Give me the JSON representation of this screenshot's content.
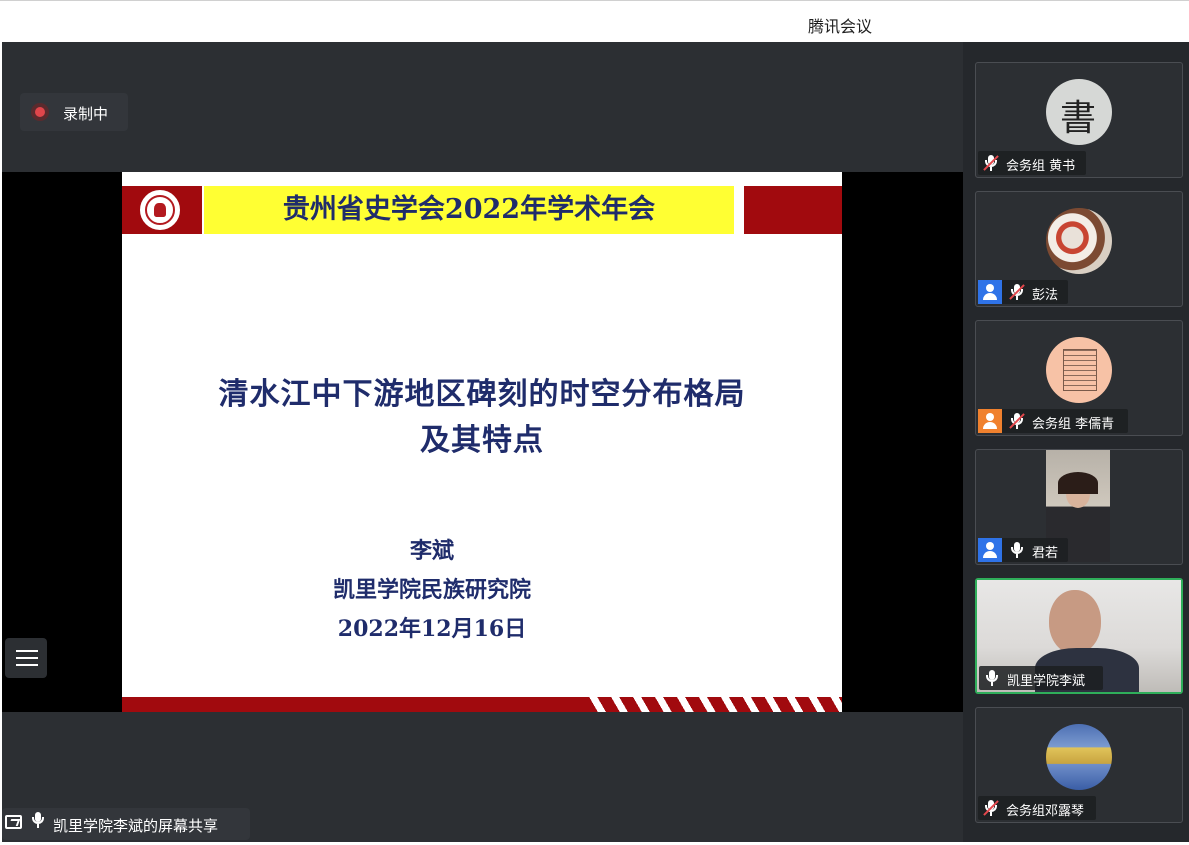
{
  "app": {
    "title": "腾讯会议"
  },
  "recording": {
    "label": "录制中"
  },
  "slide": {
    "conference_title": "贵州省史学会2022年学术年会",
    "paper_title_line1": "清水江中下游地区碑刻的时空分布格局",
    "paper_title_line2": "及其特点",
    "author": "李斌",
    "institution": "凯里学院民族研究院",
    "date": "2022年12月16日"
  },
  "share_status": {
    "label": "凯里学院李斌的屏幕共享"
  },
  "participants": [
    {
      "name": "会务组 黄书",
      "muted": true,
      "user_badge": "none"
    },
    {
      "name": "彭法",
      "muted": true,
      "user_badge": "blue"
    },
    {
      "name": "会务组 李儒青",
      "muted": true,
      "user_badge": "orange"
    },
    {
      "name": "君若",
      "muted": false,
      "user_badge": "blue"
    },
    {
      "name": "凯里学院李斌",
      "muted": false,
      "user_badge": "none",
      "active_speaker": true
    },
    {
      "name": "会务组邓露琴",
      "muted": true,
      "user_badge": "none"
    }
  ],
  "colors": {
    "slide_red": "#a10a0e",
    "slide_yellow": "#ffff33",
    "slide_text": "#1f2c6b",
    "active_border": "#2fae5a",
    "mute_red": "#e5484d"
  }
}
